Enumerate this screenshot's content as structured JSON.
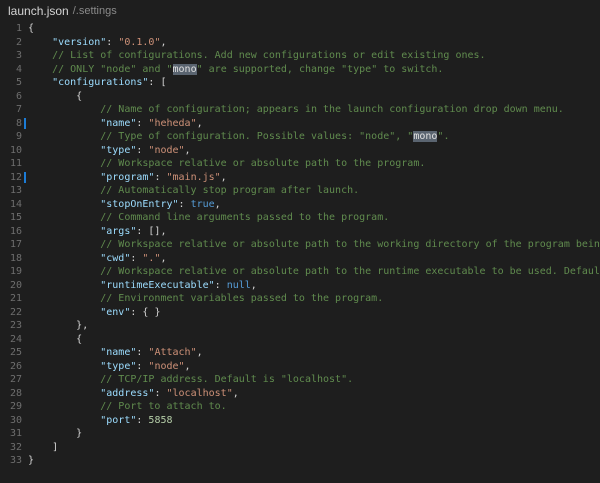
{
  "titlebar": {
    "file_name": "launch.json",
    "file_path": "/.settings"
  },
  "colors": {
    "background": "#1e1e1e",
    "key": "#9cdcfe",
    "string": "#ce9178",
    "comment": "#608b4e",
    "keyword": "#569cd6",
    "number": "#b5cea8",
    "line_number": "#6e6e6e",
    "modified_gutter": "#1c7cd6"
  },
  "editor": {
    "modified_lines": [
      8,
      12
    ],
    "lines": [
      {
        "n": "1",
        "indent": 0,
        "tokens": [
          {
            "t": "punc",
            "v": "{"
          }
        ]
      },
      {
        "n": "2",
        "indent": 1,
        "tokens": [
          {
            "t": "key",
            "v": "\"version\""
          },
          {
            "t": "punc",
            "v": ": "
          },
          {
            "t": "str",
            "v": "\"0.1.0\""
          },
          {
            "t": "punc",
            "v": ","
          }
        ]
      },
      {
        "n": "3",
        "indent": 1,
        "tokens": [
          {
            "t": "com",
            "v": "// List of configurations. Add new configurations or edit existing ones."
          }
        ]
      },
      {
        "n": "4",
        "indent": 1,
        "tokens": [
          {
            "t": "com",
            "v": "// ONLY \"node\" and \""
          },
          {
            "t": "hl",
            "v": "mono"
          },
          {
            "t": "com",
            "v": "\" are supported, change \"type\" to switch."
          }
        ]
      },
      {
        "n": "5",
        "indent": 1,
        "tokens": [
          {
            "t": "key",
            "v": "\"configurations\""
          },
          {
            "t": "punc",
            "v": ": ["
          }
        ]
      },
      {
        "n": "6",
        "indent": 2,
        "tokens": [
          {
            "t": "punc",
            "v": "{"
          }
        ]
      },
      {
        "n": "7",
        "indent": 3,
        "tokens": [
          {
            "t": "com",
            "v": "// Name of configuration; appears in the launch configuration drop down menu."
          }
        ]
      },
      {
        "n": "8",
        "indent": 3,
        "tokens": [
          {
            "t": "key",
            "v": "\"name\""
          },
          {
            "t": "punc",
            "v": ": "
          },
          {
            "t": "str",
            "v": "\"heheda\""
          },
          {
            "t": "punc",
            "v": ","
          }
        ]
      },
      {
        "n": "9",
        "indent": 3,
        "tokens": [
          {
            "t": "com",
            "v": "// Type of configuration. Possible values: \"node\", \""
          },
          {
            "t": "hl",
            "v": "mono"
          },
          {
            "t": "com",
            "v": "\"."
          }
        ]
      },
      {
        "n": "10",
        "indent": 3,
        "tokens": [
          {
            "t": "key",
            "v": "\"type\""
          },
          {
            "t": "punc",
            "v": ": "
          },
          {
            "t": "str",
            "v": "\"node\""
          },
          {
            "t": "punc",
            "v": ","
          }
        ]
      },
      {
        "n": "11",
        "indent": 3,
        "tokens": [
          {
            "t": "com",
            "v": "// Workspace relative or absolute path to the program."
          }
        ]
      },
      {
        "n": "12",
        "indent": 3,
        "tokens": [
          {
            "t": "key",
            "v": "\"program\""
          },
          {
            "t": "punc",
            "v": ": "
          },
          {
            "t": "str",
            "v": "\"main.js\""
          },
          {
            "t": "punc",
            "v": ","
          }
        ]
      },
      {
        "n": "13",
        "indent": 3,
        "tokens": [
          {
            "t": "com",
            "v": "// Automatically stop program after launch."
          }
        ]
      },
      {
        "n": "14",
        "indent": 3,
        "tokens": [
          {
            "t": "key",
            "v": "\"stopOnEntry\""
          },
          {
            "t": "punc",
            "v": ": "
          },
          {
            "t": "kw",
            "v": "true"
          },
          {
            "t": "punc",
            "v": ","
          }
        ]
      },
      {
        "n": "15",
        "indent": 3,
        "tokens": [
          {
            "t": "com",
            "v": "// Command line arguments passed to the program."
          }
        ]
      },
      {
        "n": "16",
        "indent": 3,
        "tokens": [
          {
            "t": "key",
            "v": "\"args\""
          },
          {
            "t": "punc",
            "v": ": [],"
          }
        ]
      },
      {
        "n": "17",
        "indent": 3,
        "tokens": [
          {
            "t": "com",
            "v": "// Workspace relative or absolute path to the working directory of the program being debugged."
          }
        ]
      },
      {
        "n": "18",
        "indent": 3,
        "tokens": [
          {
            "t": "key",
            "v": "\"cwd\""
          },
          {
            "t": "punc",
            "v": ": "
          },
          {
            "t": "str",
            "v": "\".\""
          },
          {
            "t": "punc",
            "v": ","
          }
        ]
      },
      {
        "n": "19",
        "indent": 3,
        "tokens": [
          {
            "t": "com",
            "v": "// Workspace relative or absolute path to the runtime executable to be used. Default is the ru"
          }
        ]
      },
      {
        "n": "20",
        "indent": 3,
        "tokens": [
          {
            "t": "key",
            "v": "\"runtimeExecutable\""
          },
          {
            "t": "punc",
            "v": ": "
          },
          {
            "t": "kw",
            "v": "null"
          },
          {
            "t": "punc",
            "v": ","
          }
        ]
      },
      {
        "n": "21",
        "indent": 3,
        "tokens": [
          {
            "t": "com",
            "v": "// Environment variables passed to the program."
          }
        ]
      },
      {
        "n": "22",
        "indent": 3,
        "tokens": [
          {
            "t": "key",
            "v": "\"env\""
          },
          {
            "t": "punc",
            "v": ": { }"
          }
        ]
      },
      {
        "n": "23",
        "indent": 2,
        "tokens": [
          {
            "t": "punc",
            "v": "},"
          }
        ]
      },
      {
        "n": "24",
        "indent": 2,
        "tokens": [
          {
            "t": "punc",
            "v": "{"
          }
        ]
      },
      {
        "n": "25",
        "indent": 3,
        "tokens": [
          {
            "t": "key",
            "v": "\"name\""
          },
          {
            "t": "punc",
            "v": ": "
          },
          {
            "t": "str",
            "v": "\"Attach\""
          },
          {
            "t": "punc",
            "v": ","
          }
        ]
      },
      {
        "n": "26",
        "indent": 3,
        "tokens": [
          {
            "t": "key",
            "v": "\"type\""
          },
          {
            "t": "punc",
            "v": ": "
          },
          {
            "t": "str",
            "v": "\"node\""
          },
          {
            "t": "punc",
            "v": ","
          }
        ]
      },
      {
        "n": "27",
        "indent": 3,
        "tokens": [
          {
            "t": "com",
            "v": "// TCP/IP address. Default is \"localhost\"."
          }
        ]
      },
      {
        "n": "28",
        "indent": 3,
        "tokens": [
          {
            "t": "key",
            "v": "\"address\""
          },
          {
            "t": "punc",
            "v": ": "
          },
          {
            "t": "str",
            "v": "\"localhost\""
          },
          {
            "t": "punc",
            "v": ","
          }
        ]
      },
      {
        "n": "29",
        "indent": 3,
        "tokens": [
          {
            "t": "com",
            "v": "// Port to attach to."
          }
        ]
      },
      {
        "n": "30",
        "indent": 3,
        "tokens": [
          {
            "t": "key",
            "v": "\"port\""
          },
          {
            "t": "punc",
            "v": ": "
          },
          {
            "t": "num",
            "v": "5858"
          }
        ]
      },
      {
        "n": "31",
        "indent": 2,
        "tokens": [
          {
            "t": "punc",
            "v": "}"
          }
        ]
      },
      {
        "n": "32",
        "indent": 1,
        "tokens": [
          {
            "t": "punc",
            "v": "]"
          }
        ]
      },
      {
        "n": "33",
        "indent": 0,
        "tokens": [
          {
            "t": "punc",
            "v": "}"
          }
        ]
      }
    ]
  }
}
